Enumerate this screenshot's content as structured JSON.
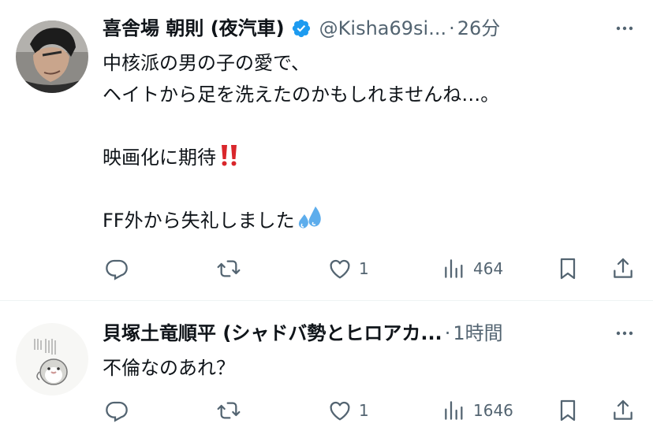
{
  "tweets": [
    {
      "author": {
        "display_name": "喜舎場 朝則 (夜汽車)",
        "verified": true,
        "handle": "@Kisha69si...",
        "time": "26分"
      },
      "lines": [
        "中核派の男の子の愛で、",
        "ヘイトから足を洗えたのかもしれませんね…。",
        "",
        "映画化に期待",
        "",
        "FF外から失礼しました"
      ],
      "emojis": [
        "double-exclamation-mark",
        "sweat-droplets"
      ],
      "actions": {
        "replies": "",
        "retweets": "",
        "likes": "1",
        "views": "464"
      }
    },
    {
      "author": {
        "display_name": "貝塚土竜順平 (シャドバ勢とヒロアカ...",
        "verified": false,
        "handle": "",
        "time": "1時間"
      },
      "lines": [
        "不倫なのあれ？"
      ],
      "emojis": [],
      "actions": {
        "replies": "",
        "retweets": "",
        "likes": "1",
        "views": "1646"
      }
    }
  ],
  "separator": "·",
  "colors": {
    "text": "#0f1419",
    "secondary": "#536471",
    "verified_blue": "#1d9bf0",
    "divider": "#eff3f4",
    "emoji_red": "#d9262b",
    "emoji_blue": "#5dadec"
  }
}
